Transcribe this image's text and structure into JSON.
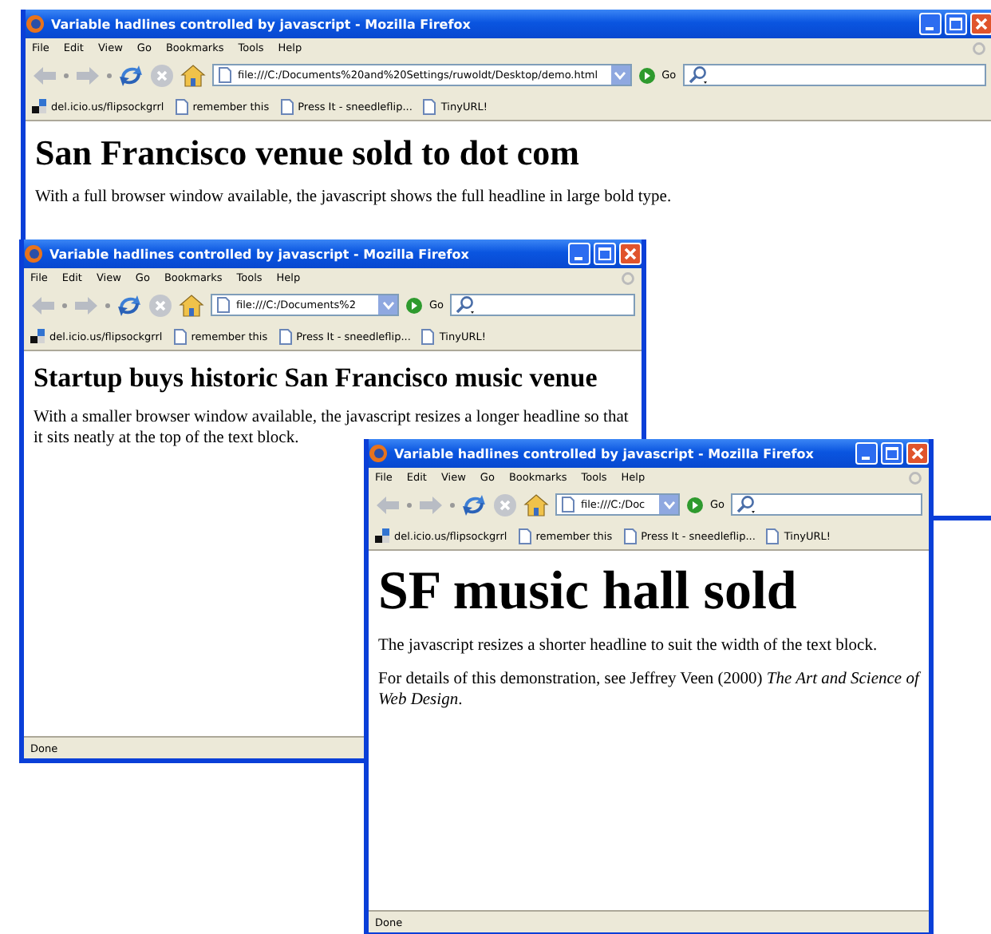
{
  "windows": [
    {
      "title": "Variable hadlines controlled by javascript - Mozilla Firefox",
      "menu": [
        "File",
        "Edit",
        "View",
        "Go",
        "Bookmarks",
        "Tools",
        "Help"
      ],
      "address": "file:///C:/Documents%20and%20Settings/ruwoldt/Desktop/demo.html",
      "go_label": "Go",
      "bookmarks": [
        "del.icio.us/flipsockgrrl",
        "remember this",
        "Press It - sneedleflip...",
        "TinyURL!"
      ],
      "headline": "San Francisco venue sold to dot com",
      "paragraphs": [
        "With a full browser window available, the javascript shows the full headline in large bold type."
      ]
    },
    {
      "title": "Variable hadlines controlled by javascript - Mozilla Firefox",
      "menu": [
        "File",
        "Edit",
        "View",
        "Go",
        "Bookmarks",
        "Tools",
        "Help"
      ],
      "address": "file:///C:/Documents%2",
      "go_label": "Go",
      "bookmarks": [
        "del.icio.us/flipsockgrrl",
        "remember this",
        "Press It - sneedleflip...",
        "TinyURL!"
      ],
      "headline": "Startup buys historic San Francisco music venue",
      "paragraphs": [
        "With a smaller browser window available, the javascript resizes a longer headline so that it sits neatly at the top of the text block."
      ],
      "status": "Done"
    },
    {
      "title": "Variable hadlines controlled by javascript - Mozilla Firefox",
      "menu": [
        "File",
        "Edit",
        "View",
        "Go",
        "Bookmarks",
        "Tools",
        "Help"
      ],
      "address": "file:///C:/Doc",
      "go_label": "Go",
      "bookmarks": [
        "del.icio.us/flipsockgrrl",
        "remember this",
        "Press It - sneedleflip...",
        "TinyURL!"
      ],
      "headline": "SF music hall sold",
      "paragraphs": [
        "The javascript resizes a shorter headline to suit the width of the text block.",
        "For details of this demonstration, see Jeffrey Veen (2000) *The Art and Science of Web Design*."
      ],
      "status": "Done"
    }
  ]
}
